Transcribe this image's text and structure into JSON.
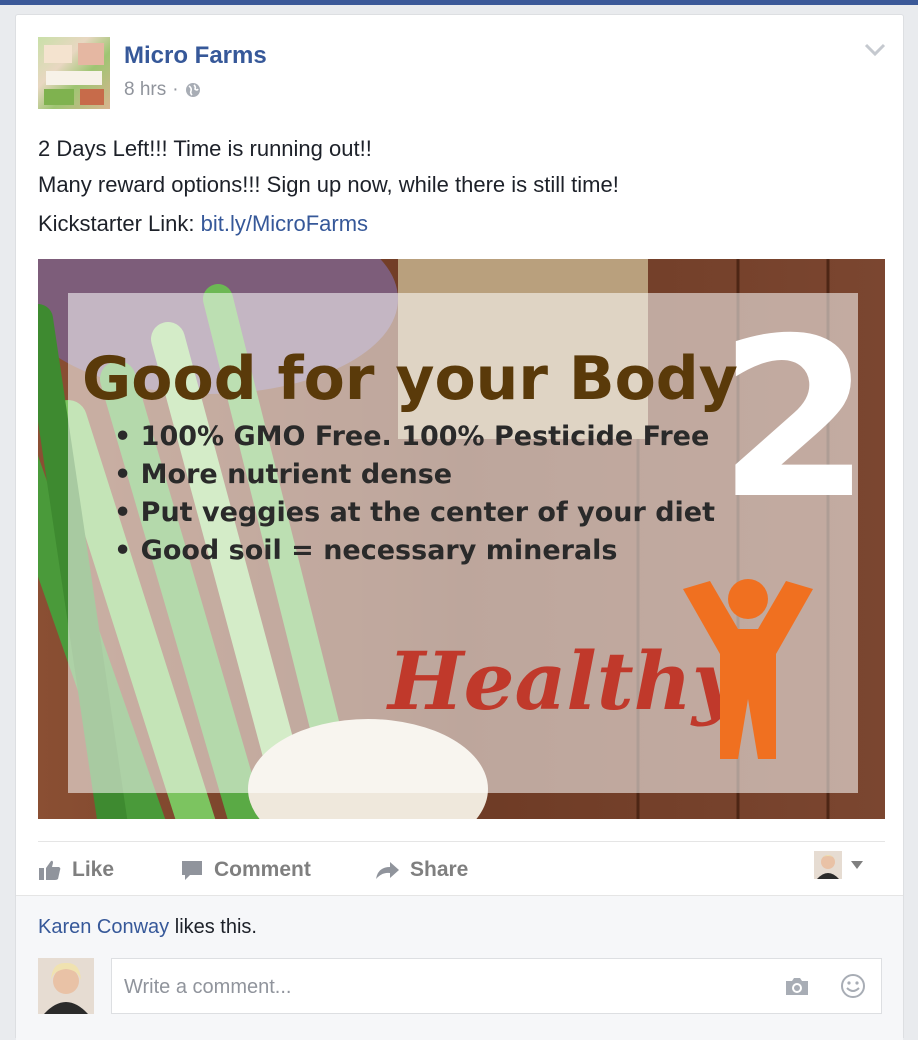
{
  "post": {
    "page_name": "Micro Farms",
    "time": "8 hrs",
    "separator": "·",
    "text_line1": "2 Days Left!!! Time is running out!!",
    "text_line2": "Many reward options!!! Sign up now, while there is still time!",
    "link_prefix": "Kickstarter Link: ",
    "link_text": "bit.ly/MicroFarms"
  },
  "image": {
    "title": "Good for your Body",
    "bullets": [
      "• 100% GMO Free. 100% Pesticide Free",
      "• More nutrient dense",
      "• Put veggies at the center of your diet",
      "• Good soil = necessary minerals"
    ],
    "number": "2",
    "script_word": "Healthy"
  },
  "actions": {
    "like": "Like",
    "comment": "Comment",
    "share": "Share"
  },
  "footer": {
    "liker_name": "Karen Conway",
    "likes_suffix": " likes this.",
    "comment_placeholder": "Write a comment..."
  },
  "colors": {
    "brand": "#3b5998",
    "link": "#365899",
    "muted": "#90949c",
    "orange": "#f07020",
    "script_red": "#c0392b"
  }
}
